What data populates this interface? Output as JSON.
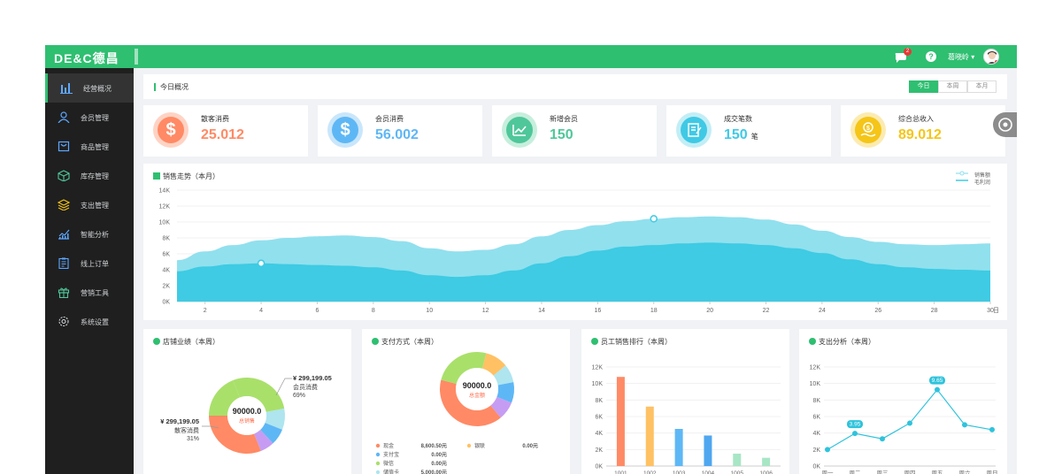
{
  "header": {
    "logo": "DE&C德昌",
    "notification_count": "2",
    "user_name": "葛晓岭 ▾",
    "colors": {
      "brand": "#2fbf71",
      "sidebar": "#1f1f1f"
    }
  },
  "sidebar": {
    "items": [
      {
        "label": "经营概况",
        "icon": "bar-chart-icon",
        "active": true
      },
      {
        "label": "会员管理",
        "icon": "user-icon"
      },
      {
        "label": "商品管理",
        "icon": "bag-icon"
      },
      {
        "label": "库存管理",
        "icon": "box-icon"
      },
      {
        "label": "支出管理",
        "icon": "layers-icon"
      },
      {
        "label": "智能分析",
        "icon": "analytics-icon"
      },
      {
        "label": "线上订单",
        "icon": "clipboard-icon"
      },
      {
        "label": "营销工具",
        "icon": "gift-icon"
      },
      {
        "label": "系统设置",
        "icon": "gear-icon"
      }
    ]
  },
  "today": {
    "title": "今日概况",
    "tabs": [
      {
        "label": "今日"
      },
      {
        "label": "本周"
      },
      {
        "label": "本月"
      }
    ]
  },
  "cards": [
    {
      "label": "散客消费",
      "value": "25.012",
      "unit": "",
      "color": "#ff8a65",
      "icon": "$"
    },
    {
      "label": "会员消费",
      "value": "56.002",
      "unit": "",
      "color": "#5eb7f5",
      "icon": "$"
    },
    {
      "label": "新增会员",
      "value": "150",
      "unit": "",
      "color": "#4fc79a",
      "icon": "trend"
    },
    {
      "label": "成交笔数",
      "value": "150",
      "unit": "笔",
      "color": "#40c9e5",
      "icon": "note"
    },
    {
      "label": "综合总收入",
      "value": "89.012",
      "unit": "",
      "color": "#f5c518",
      "icon": "coin"
    }
  ],
  "trend": {
    "title": "销售走势（本月）",
    "legend": [
      "销售额",
      "毛利润"
    ],
    "x_unit": "日"
  },
  "chart_data": [
    {
      "type": "area",
      "title": "销售走势（本月）",
      "x": [
        1,
        2,
        3,
        4,
        5,
        6,
        7,
        8,
        9,
        10,
        11,
        12,
        13,
        14,
        15,
        16,
        17,
        18,
        19,
        20,
        21,
        22,
        23,
        24,
        25,
        26,
        27,
        28,
        29,
        30
      ],
      "xticks": [
        "2",
        "4",
        "6",
        "8",
        "10",
        "12",
        "14",
        "16",
        "18",
        "20",
        "22",
        "24",
        "26",
        "28",
        "30"
      ],
      "yticks": [
        "0K",
        "2K",
        "4K",
        "6K",
        "8K",
        "10K",
        "12K",
        "14K"
      ],
      "ylim": [
        0,
        14000
      ],
      "series": [
        {
          "name": "销售额",
          "values": [
            5200,
            6300,
            7100,
            7700,
            8000,
            8200,
            8300,
            8100,
            7600,
            6700,
            6300,
            6500,
            7200,
            8200,
            9000,
            9600,
            10100,
            10400,
            10600,
            10700,
            10600,
            10300,
            9700,
            8900,
            8100,
            7500,
            7200,
            7100,
            7200,
            7300
          ]
        },
        {
          "name": "毛利润",
          "values": [
            3800,
            4400,
            4700,
            4800,
            4700,
            4600,
            4500,
            4300,
            3900,
            3300,
            3100,
            3300,
            3900,
            4800,
            5700,
            6400,
            6900,
            7100,
            7300,
            7400,
            7300,
            7100,
            6700,
            6100,
            5300,
            4700,
            4300,
            4100,
            4000,
            3900
          ]
        }
      ],
      "colors": [
        "#91e0ee",
        "#3ecbe3"
      ]
    },
    {
      "type": "pie",
      "title": "店铺业绩（本周）",
      "center_value": "90000.0",
      "center_label": "总销售",
      "annotations": [
        {
          "value": "¥ 299,199.05",
          "label": "会员消费",
          "percent": "69%"
        },
        {
          "value": "¥ 299,199.05",
          "label": "散客消费",
          "percent": "31%"
        }
      ],
      "slices": [
        {
          "name": "会员消费",
          "value": 69,
          "color": "#a9e06a"
        },
        {
          "name": "散客消费",
          "value": 31,
          "color": "#ff8a65"
        }
      ]
    },
    {
      "type": "pie",
      "title": "支付方式（本周）",
      "center_value": "90000.0",
      "center_label": "总金额",
      "slices": [
        {
          "name": "现金",
          "value": 40,
          "color": "#ff8a65"
        },
        {
          "name": "微信",
          "value": 25,
          "color": "#a9e06a"
        },
        {
          "name": "银联",
          "value": 10,
          "color": "#ffc163"
        },
        {
          "name": "储值卡",
          "value": 8,
          "color": "#aee5ef"
        },
        {
          "name": "支付宝",
          "value": 9,
          "color": "#5eb7f5"
        },
        {
          "name": "其他",
          "value": 8,
          "color": "#c69cf2"
        }
      ],
      "legend": [
        {
          "name": "现金",
          "value": "8,600.50元",
          "color": "#ff8a65"
        },
        {
          "name": "银联",
          "value": "0.00元",
          "color": "#ffc163"
        },
        {
          "name": "支付宝",
          "value": "0.00元",
          "color": "#5eb7f5"
        },
        {
          "name": "微信",
          "value": "0.00元",
          "color": "#a9e06a"
        },
        {
          "name": "储值卡",
          "value": "5,000.00元",
          "color": "#aee5ef"
        }
      ]
    },
    {
      "type": "bar",
      "title": "员工销售排行（本周）",
      "categories": [
        "1001",
        "1002",
        "1003",
        "1004",
        "1005",
        "1006"
      ],
      "values": [
        10800,
        7200,
        4500,
        3700,
        1500,
        1000
      ],
      "colors": [
        "#ff8a65",
        "#ffc163",
        "#5eb7f5",
        "#4fa7f0",
        "#a8e6c5",
        "#a8e6c5"
      ],
      "yticks": [
        "0K",
        "2K",
        "4K",
        "6K",
        "8K",
        "10K",
        "12K"
      ],
      "ylim": [
        0,
        12000
      ]
    },
    {
      "type": "line",
      "title": "支出分析（本周）",
      "categories": [
        "周一",
        "周二",
        "周三",
        "周四",
        "周五",
        "周六",
        "周日"
      ],
      "values": [
        2000,
        3950,
        3300,
        5200,
        9250,
        5000,
        4400
      ],
      "labels": [
        "",
        "3.95",
        "",
        "",
        "9.65",
        "",
        ""
      ],
      "yticks": [
        "0K",
        "2K",
        "4K",
        "6K",
        "8K",
        "10K",
        "12K"
      ],
      "ylim": [
        0,
        12000
      ],
      "color": "#2ec3dc"
    }
  ]
}
